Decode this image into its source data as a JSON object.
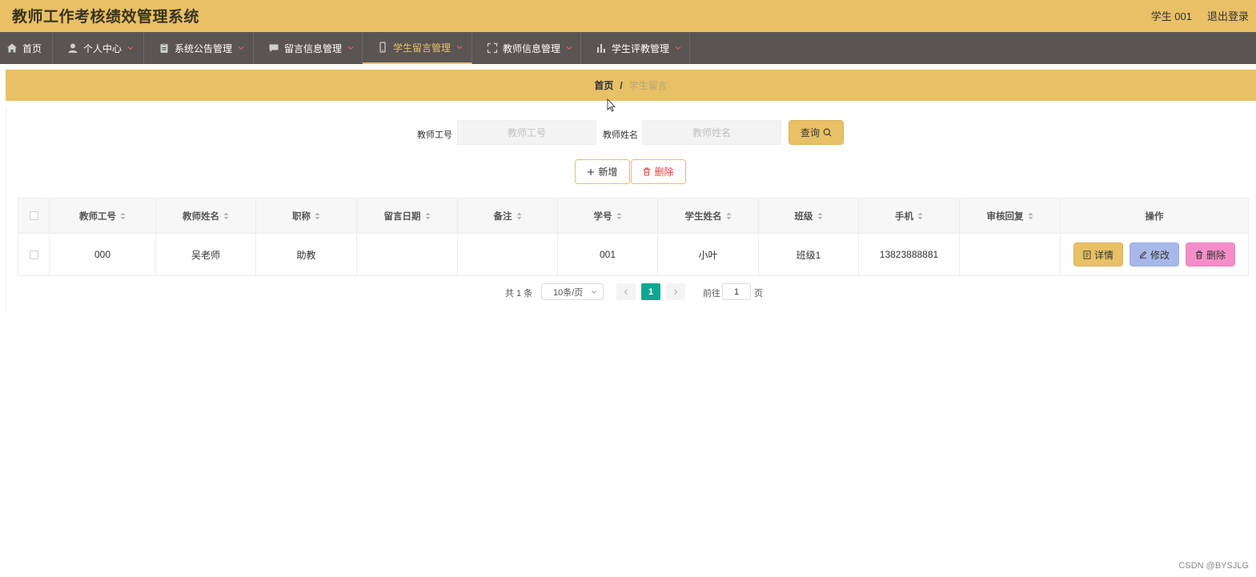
{
  "header": {
    "title": "教师工作考核绩效管理系统",
    "user": "学生 001",
    "logout": "退出登录"
  },
  "nav": [
    {
      "label": "首页",
      "icon": "home-icon",
      "caret": false
    },
    {
      "label": "个人中心",
      "icon": "user-icon",
      "caret": true
    },
    {
      "label": "系统公告管理",
      "icon": "clipboard-icon",
      "caret": true
    },
    {
      "label": "留言信息管理",
      "icon": "message-icon",
      "caret": true
    },
    {
      "label": "学生留言管理",
      "icon": "mobile-icon",
      "caret": true,
      "active": true
    },
    {
      "label": "教师信息管理",
      "icon": "fullscreen-icon",
      "caret": true
    },
    {
      "label": "学生评教管理",
      "icon": "bar-chart-icon",
      "caret": true
    }
  ],
  "breadcrumb": {
    "home": "首页",
    "separator": "/",
    "current": "学生留言"
  },
  "search": {
    "teacher_id_label": "教师工号",
    "teacher_id_placeholder": "教师工号",
    "teacher_name_label": "教师姓名",
    "teacher_name_placeholder": "教师姓名",
    "query_button": "查询"
  },
  "actions": {
    "add": "新增",
    "delete": "删除"
  },
  "table": {
    "columns": [
      "教师工号",
      "教师姓名",
      "职称",
      "留言日期",
      "备注",
      "学号",
      "学生姓名",
      "班级",
      "手机",
      "审核回复",
      "操作"
    ],
    "rows": [
      {
        "teacher_id": "000",
        "teacher_name": "吴老师",
        "title": "助教",
        "date": "",
        "note": "",
        "student_id": "001",
        "student_name": "小叶",
        "class": "班级1",
        "phone": "13823888881",
        "reply": ""
      }
    ],
    "row_actions": {
      "detail": "详情",
      "edit": "修改",
      "delete": "删除"
    }
  },
  "pagination": {
    "total": "共 1 条",
    "page_size": "10条/页",
    "current_page": "1",
    "goto_prefix": "前往",
    "goto_value": "1",
    "goto_suffix": "页"
  },
  "watermark": "CSDN @BYSJLG",
  "colors": {
    "accent": "#e8c066",
    "nav_bg": "#5a5553",
    "page_active": "#10a690",
    "detail_btn": "#e8c066",
    "edit_btn": "#a8b8e8",
    "delete_btn": "#f48ec8"
  }
}
